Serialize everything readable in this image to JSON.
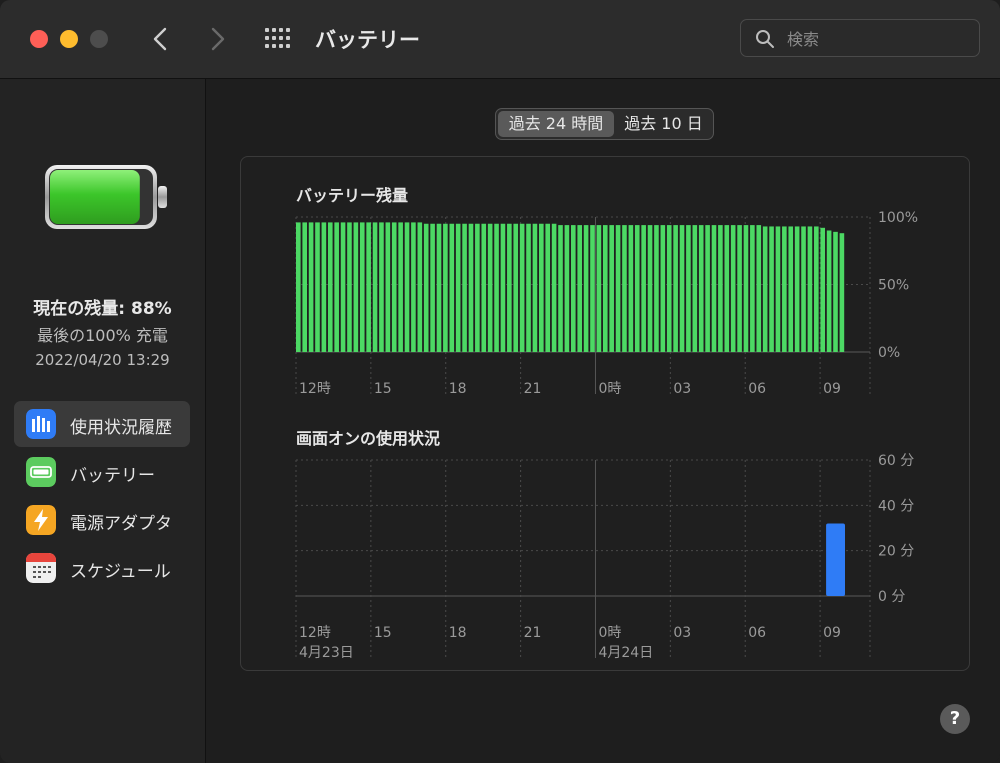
{
  "window": {
    "title": "バッテリー",
    "search_placeholder": "検索",
    "traffic_lights": [
      "close",
      "minimize",
      "zoom"
    ]
  },
  "sidebar": {
    "charge_level_label": "現在の残量: 88%",
    "last_full_charge_label": "最後の100% 充電",
    "last_full_charge_time": "2022/04/20 13:29",
    "battery_level": 0.88,
    "items": [
      {
        "label": "使用状況履歴",
        "icon": "usage-history-icon",
        "active": true
      },
      {
        "label": "バッテリー",
        "icon": "battery-icon",
        "active": false
      },
      {
        "label": "電源アダプタ",
        "icon": "power-adapter-icon",
        "active": false
      },
      {
        "label": "スケジュール",
        "icon": "calendar-icon",
        "active": false
      }
    ]
  },
  "segmented": {
    "options": [
      "過去 24 時間",
      "過去 10 日"
    ],
    "selected": 0
  },
  "help_label": "?",
  "colors": {
    "battery_bar": "#4cd964",
    "screen_bar": "#2f7cf6",
    "active_icon": "#2f7cf6",
    "battery_icon_bg": "#5ccb5f",
    "adapter_icon_bg": "#f5a623"
  },
  "chart_data": [
    {
      "type": "bar",
      "title": "バッテリー残量",
      "y_tick_labels": [
        "100%",
        "50%",
        "0%"
      ],
      "ylim": [
        0,
        100
      ],
      "x_tick_labels": [
        "12時",
        "15",
        "18",
        "21",
        "0時",
        "03",
        "06",
        "09"
      ],
      "values": [
        96,
        96,
        96,
        96,
        96,
        96,
        96,
        96,
        96,
        96,
        96,
        96,
        96,
        96,
        96,
        96,
        96,
        96,
        96,
        96,
        95,
        95,
        95,
        95,
        95,
        95,
        95,
        95,
        95,
        95,
        95,
        95,
        95,
        95,
        95,
        95,
        95,
        95,
        95,
        95,
        95,
        94,
        94,
        94,
        94,
        94,
        94,
        94,
        94,
        94,
        94,
        94,
        94,
        94,
        94,
        94,
        94,
        94,
        94,
        94,
        94,
        94,
        94,
        94,
        94,
        94,
        94,
        94,
        94,
        94,
        94,
        94,
        94,
        93,
        93,
        93,
        93,
        93,
        93,
        93,
        93,
        93,
        92,
        90,
        89,
        88
      ],
      "series": [
        {
          "name": "",
          "color": "#4cd964"
        }
      ]
    },
    {
      "type": "bar",
      "title": "画面オンの使用状況",
      "y_tick_labels": [
        "60 分",
        "40 分",
        "20 分",
        "0 分"
      ],
      "ylim": [
        0,
        60
      ],
      "x_tick_labels": [
        "12時",
        "15",
        "18",
        "21",
        "0時",
        "03",
        "06",
        "09"
      ],
      "date_labels": [
        "4月23日",
        "4月24日"
      ],
      "bar_slot": 22,
      "slot_count": 23,
      "values_minutes": [
        32
      ],
      "series": [
        {
          "name": "",
          "color": "#2f7cf6"
        }
      ]
    }
  ]
}
